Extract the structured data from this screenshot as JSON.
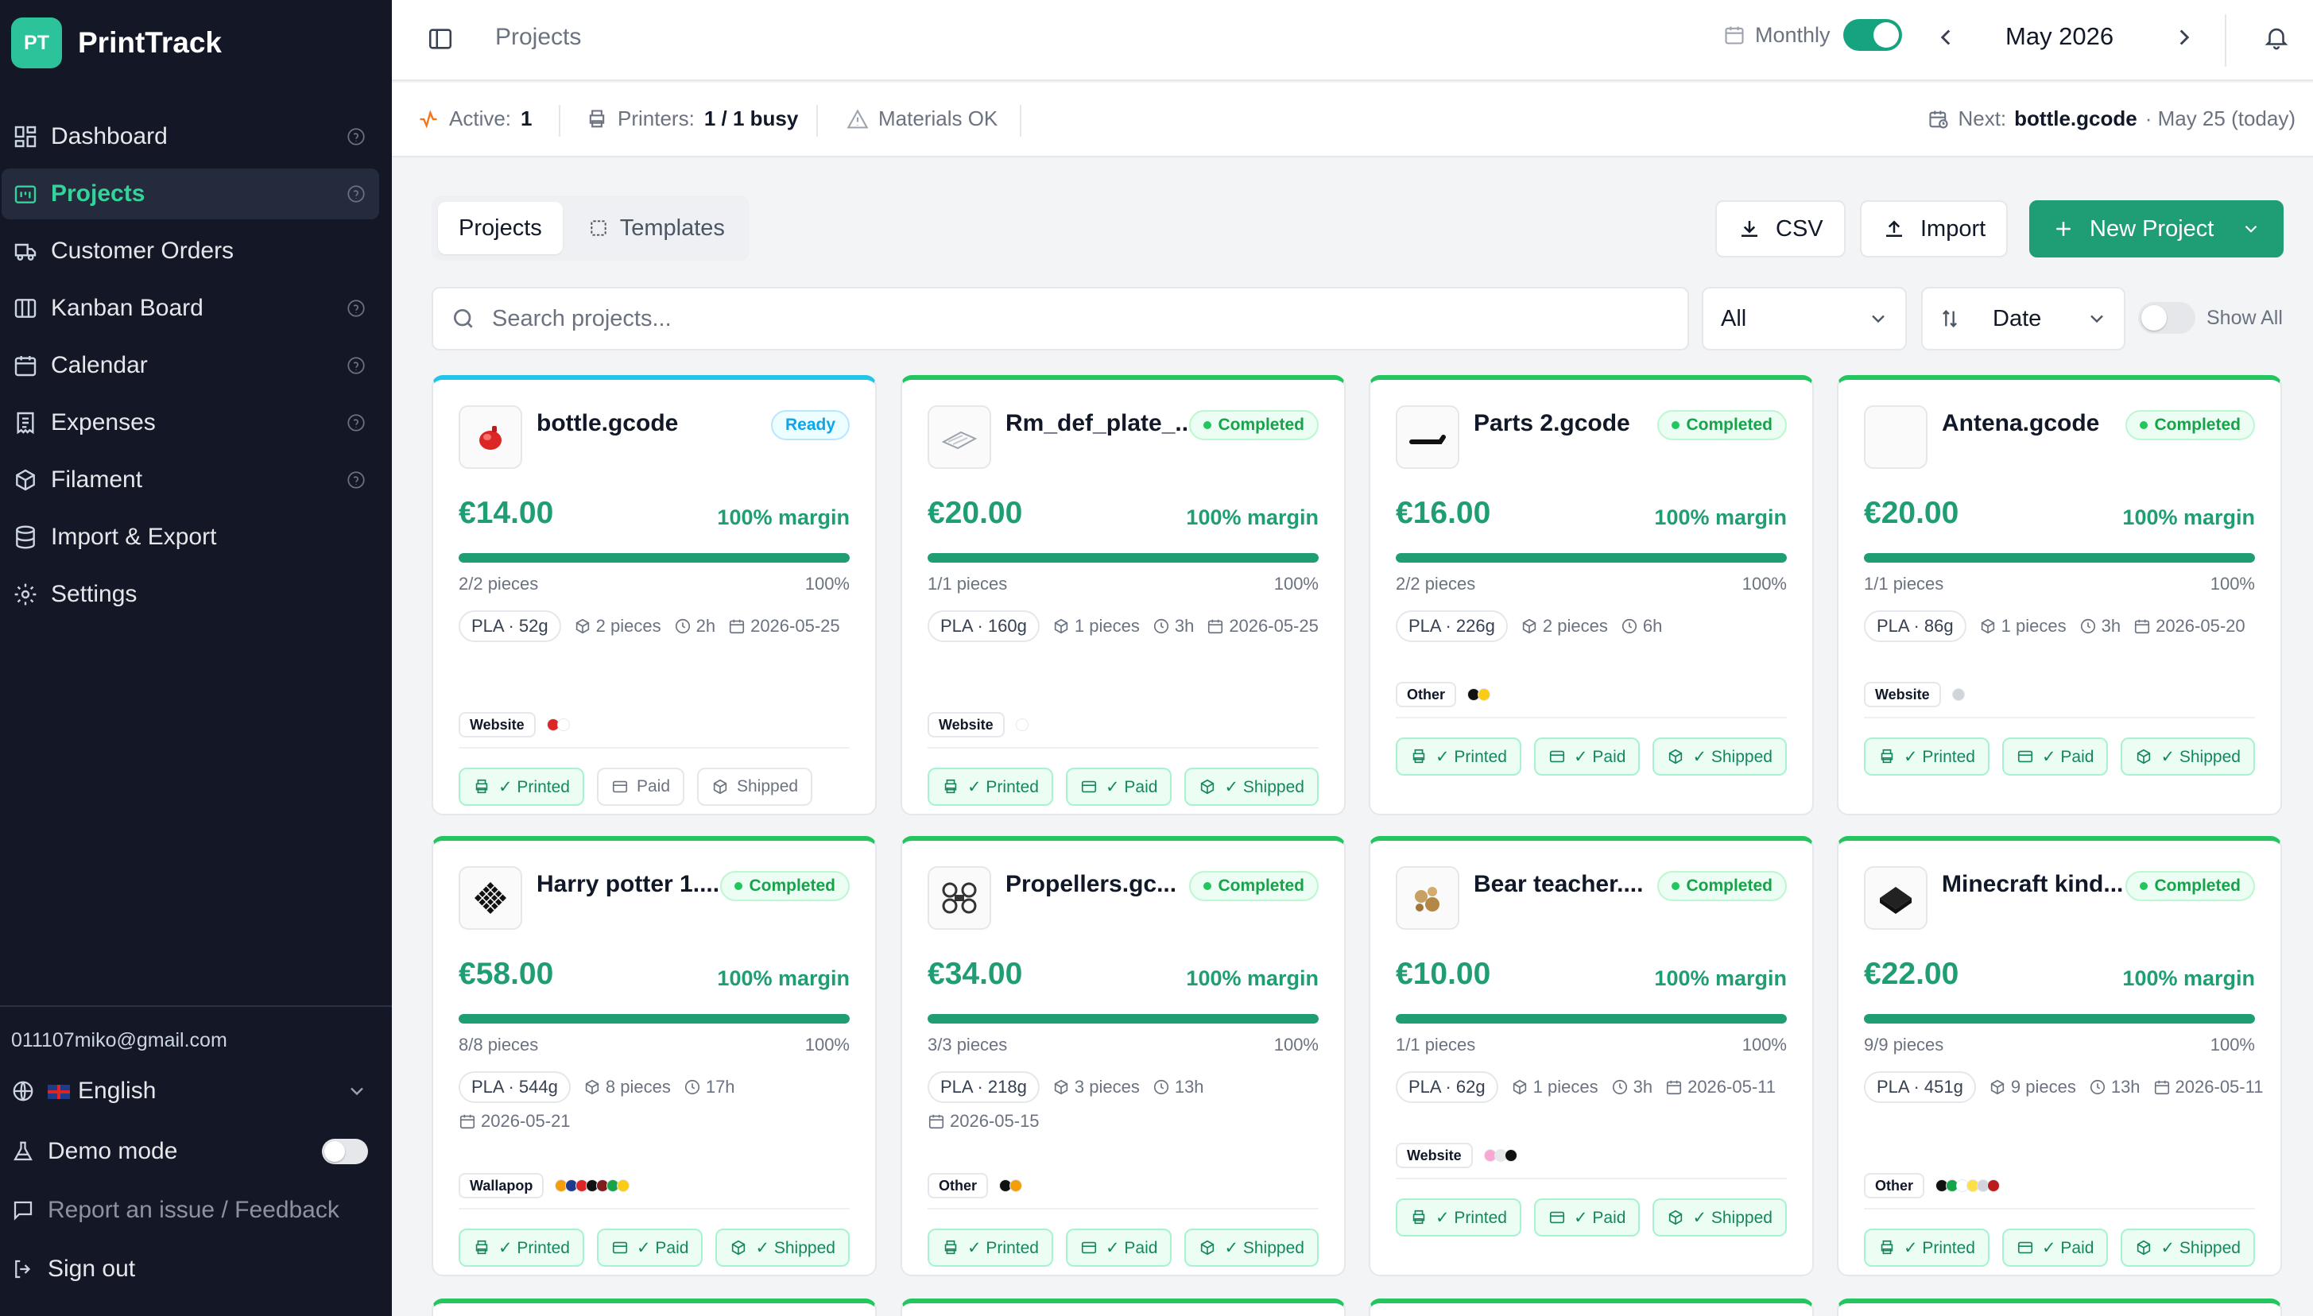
{
  "brand": {
    "initials": "PT",
    "name": "PrintTrack"
  },
  "nav": [
    {
      "label": "Dashboard",
      "icon": "dashboard-icon",
      "help": true,
      "active": false
    },
    {
      "label": "Projects",
      "icon": "projects-icon",
      "help": true,
      "active": true
    },
    {
      "label": "Customer Orders",
      "icon": "truck-icon",
      "help": false,
      "active": false
    },
    {
      "label": "Kanban Board",
      "icon": "kanban-icon",
      "help": true,
      "active": false
    },
    {
      "label": "Calendar",
      "icon": "calendar-icon",
      "help": true,
      "active": false
    },
    {
      "label": "Expenses",
      "icon": "receipt-icon",
      "help": true,
      "active": false
    },
    {
      "label": "Filament",
      "icon": "box-icon",
      "help": true,
      "active": false
    },
    {
      "label": "Import & Export",
      "icon": "database-icon",
      "help": false,
      "active": false
    },
    {
      "label": "Settings",
      "icon": "gear-icon",
      "help": false,
      "active": false
    }
  ],
  "sidebar_footer": {
    "email": "011107miko@gmail.com",
    "language": "English",
    "demo_mode": "Demo mode",
    "demo_mode_on": false,
    "feedback": "Report an issue / Feedback",
    "sign_out": "Sign out"
  },
  "topbar": {
    "breadcrumb": "Projects",
    "monthly_label": "Monthly",
    "monthly_on": true,
    "month": "May 2026"
  },
  "status": {
    "active_label": "Active:",
    "active_value": "1",
    "printers_label": "Printers:",
    "printers_value": "1 / 1 busy",
    "materials": "Materials OK",
    "next_label": "Next:",
    "next_file": "bottle.gcode",
    "next_when": "· May 25 (today)"
  },
  "toolbar": {
    "tab_projects": "Projects",
    "tab_templates": "Templates",
    "csv": "CSV",
    "import": "Import",
    "new_project": "New Project",
    "search_placeholder": "Search projects...",
    "filter_value": "All",
    "sort_value": "Date",
    "show_all": "Show All",
    "show_all_on": false
  },
  "colors": {
    "accent": "#1f9d74",
    "sidebar": "#141826",
    "completed": "#22c55e",
    "ready": "#22c5e8"
  },
  "projects": [
    {
      "name": "bottle.gcode",
      "status": "Ready",
      "thumb": "red-bottle-thumb",
      "price": "€14.00",
      "margin": "100% margin",
      "pieces": "2/2 pieces",
      "progress": 100,
      "progress_label": "100%",
      "material": "PLA · 52g",
      "count": "2 pieces",
      "time": "2h",
      "date": "2026-05-25",
      "source": "Website",
      "colors": [
        "#dc2626",
        "#ffffff"
      ],
      "printed": "✓ Printed",
      "paid": "Paid",
      "shipped": "Shipped",
      "printed_done": true,
      "paid_done": false,
      "shipped_done": false
    },
    {
      "name": "Rm_def_plate_...",
      "status": "Completed",
      "thumb": "plate-thumb",
      "price": "€20.00",
      "margin": "100% margin",
      "pieces": "1/1 pieces",
      "progress": 100,
      "progress_label": "100%",
      "material": "PLA · 160g",
      "count": "1 pieces",
      "time": "3h",
      "date": "2026-05-25",
      "source": "Website",
      "colors": [
        "#ffffff"
      ],
      "printed": "✓ Printed",
      "paid": "✓ Paid",
      "shipped": "✓ Shipped",
      "printed_done": true,
      "paid_done": true,
      "shipped_done": true
    },
    {
      "name": "Parts 2.gcode",
      "status": "Completed",
      "thumb": "bar-thumb",
      "price": "€16.00",
      "margin": "100% margin",
      "pieces": "2/2 pieces",
      "progress": 100,
      "progress_label": "100%",
      "material": "PLA · 226g",
      "count": "2 pieces",
      "time": "6h",
      "date": "",
      "source": "Other",
      "colors": [
        "#111111",
        "#facc15"
      ],
      "printed": "✓ Printed",
      "paid": "✓ Paid",
      "shipped": "✓ Shipped",
      "printed_done": true,
      "paid_done": true,
      "shipped_done": true
    },
    {
      "name": "Antena.gcode",
      "status": "Completed",
      "thumb": "empty-thumb",
      "price": "€20.00",
      "margin": "100% margin",
      "pieces": "1/1 pieces",
      "progress": 100,
      "progress_label": "100%",
      "material": "PLA · 86g",
      "count": "1 pieces",
      "time": "3h",
      "date": "2026-05-20",
      "source": "Website",
      "colors": [
        "#d1d5db"
      ],
      "printed": "✓ Printed",
      "paid": "✓ Paid",
      "shipped": "✓ Shipped",
      "printed_done": true,
      "paid_done": true,
      "shipped_done": true
    },
    {
      "name": "Harry potter 1....",
      "status": "Completed",
      "thumb": "grid-thumb",
      "price": "€58.00",
      "margin": "100% margin",
      "pieces": "8/8 pieces",
      "progress": 100,
      "progress_label": "100%",
      "material": "PLA · 544g",
      "count": "8 pieces",
      "time": "17h",
      "date": "2026-05-21",
      "source": "Wallapop",
      "colors": [
        "#f59e0b",
        "#1e3a8a",
        "#dc2626",
        "#111111",
        "#7f1d1d",
        "#16a34a",
        "#facc15"
      ],
      "printed": "✓ Printed",
      "paid": "✓ Paid",
      "shipped": "✓ Shipped",
      "printed_done": true,
      "paid_done": true,
      "shipped_done": true
    },
    {
      "name": "Propellers.gc...",
      "status": "Completed",
      "thumb": "drone-thumb",
      "price": "€34.00",
      "margin": "100% margin",
      "pieces": "3/3 pieces",
      "progress": 100,
      "progress_label": "100%",
      "material": "PLA · 218g",
      "count": "3 pieces",
      "time": "13h",
      "date": "2026-05-15",
      "source": "Other",
      "colors": [
        "#111111",
        "#f59e0b"
      ],
      "printed": "✓ Printed",
      "paid": "✓ Paid",
      "shipped": "✓ Shipped",
      "printed_done": true,
      "paid_done": true,
      "shipped_done": true
    },
    {
      "name": "Bear teacher....",
      "status": "Completed",
      "thumb": "bear-thumb",
      "price": "€10.00",
      "margin": "100% margin",
      "pieces": "1/1 pieces",
      "progress": 100,
      "progress_label": "100%",
      "material": "PLA · 62g",
      "count": "1 pieces",
      "time": "3h",
      "date": "2026-05-11",
      "source": "Website",
      "colors": [
        "#f9a8d4",
        "#e5e7eb",
        "#111111"
      ],
      "printed": "✓ Printed",
      "paid": "✓ Paid",
      "shipped": "✓ Shipped",
      "printed_done": true,
      "paid_done": true,
      "shipped_done": true
    },
    {
      "name": "Minecraft kind...",
      "status": "Completed",
      "thumb": "block-thumb",
      "price": "€22.00",
      "margin": "100% margin",
      "pieces": "9/9 pieces",
      "progress": 100,
      "progress_label": "100%",
      "material": "PLA · 451g",
      "count": "9 pieces",
      "time": "13h",
      "date": "2026-05-11",
      "source": "Other",
      "colors": [
        "#111111",
        "#16a34a",
        "#ffffff",
        "#fde047",
        "#d1d5db",
        "#b91c1c"
      ],
      "printed": "✓ Printed",
      "paid": "✓ Paid",
      "shipped": "✓ Shipped",
      "printed_done": true,
      "paid_done": true,
      "shipped_done": true
    }
  ]
}
